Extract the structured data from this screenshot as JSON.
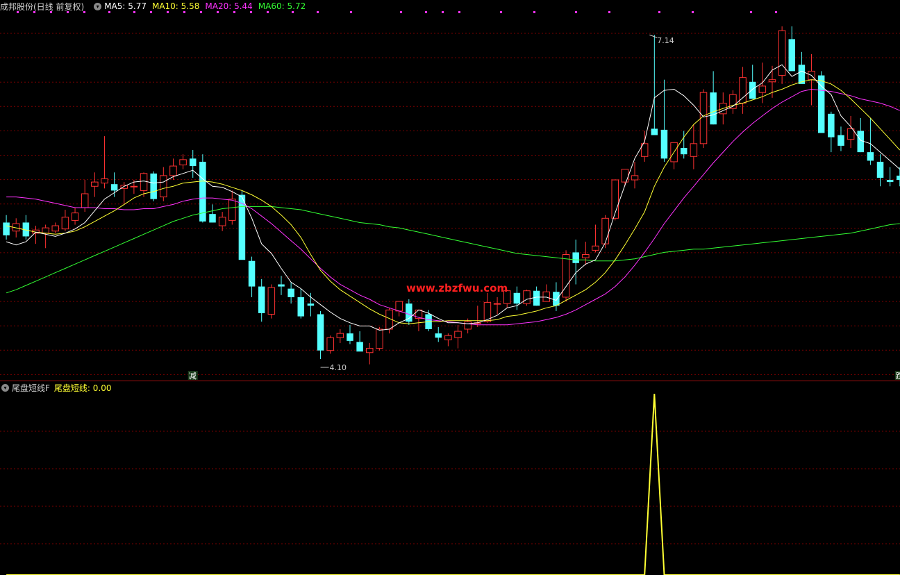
{
  "header": {
    "title": "成邦股份(日线 前复权)",
    "ma5_label": "MA5: 5.77",
    "ma10_label": "MA10: 5.58",
    "ma20_label": "MA20: 5.44",
    "ma60_label": "MA60: 5.72"
  },
  "indicator_header": {
    "name": "尾盘短线F",
    "value_label": "尾盘短线: 0.00"
  },
  "watermark": "www.zbzfwu.com",
  "colors": {
    "up": "#ff3232",
    "down": "#54ffff",
    "ma5": "#ffffff",
    "ma10": "#ffff33",
    "ma20": "#ff33ff",
    "ma60": "#33ff33",
    "grid": "#7a0000",
    "indicator": "#ffff33",
    "watermark": "#ff2020",
    "marker": "#ff33ff"
  },
  "chart_data": [
    {
      "type": "candlestick",
      "series_legend": [
        "MA5",
        "MA10",
        "MA20",
        "MA60"
      ],
      "ylim": [
        3.95,
        7.35
      ],
      "grid": true,
      "annotations": [
        {
          "text": "7.14",
          "kind": "high",
          "index": 66,
          "value": 7.14
        },
        {
          "text": "4.10",
          "kind": "low",
          "index": 32,
          "value": 4.1
        },
        {
          "text": "减",
          "index": 19
        },
        {
          "text": "跌",
          "index": 91
        }
      ],
      "ohlc": [
        [
          5.38,
          5.45,
          5.22,
          5.26
        ],
        [
          5.3,
          5.42,
          5.24,
          5.37
        ],
        [
          5.38,
          5.45,
          5.22,
          5.25
        ],
        [
          5.28,
          5.35,
          5.18,
          5.31
        ],
        [
          5.28,
          5.36,
          5.14,
          5.33
        ],
        [
          5.3,
          5.38,
          5.28,
          5.35
        ],
        [
          5.32,
          5.5,
          5.3,
          5.43
        ],
        [
          5.4,
          5.52,
          5.36,
          5.47
        ],
        [
          5.52,
          5.78,
          5.48,
          5.65
        ],
        [
          5.72,
          5.85,
          5.62,
          5.76
        ],
        [
          5.75,
          6.19,
          5.7,
          5.79
        ],
        [
          5.74,
          5.85,
          5.62,
          5.68
        ],
        [
          5.7,
          5.76,
          5.55,
          5.73
        ],
        [
          5.72,
          5.78,
          5.65,
          5.72
        ],
        [
          5.68,
          5.85,
          5.62,
          5.84
        ],
        [
          5.84,
          5.86,
          5.58,
          5.6
        ],
        [
          5.62,
          5.9,
          5.58,
          5.82
        ],
        [
          5.82,
          5.98,
          5.78,
          5.91
        ],
        [
          5.92,
          6.02,
          5.88,
          5.97
        ],
        [
          5.98,
          6.06,
          5.8,
          5.91
        ],
        [
          5.95,
          6.02,
          5.38,
          5.39
        ],
        [
          5.46,
          5.55,
          5.38,
          5.38
        ],
        [
          5.35,
          5.48,
          5.3,
          5.43
        ],
        [
          5.4,
          5.68,
          5.36,
          5.6
        ],
        [
          5.64,
          5.68,
          5.05,
          5.03
        ],
        [
          5.02,
          5.06,
          4.68,
          4.78
        ],
        [
          4.78,
          4.85,
          4.45,
          4.53
        ],
        [
          4.52,
          4.8,
          4.48,
          4.77
        ],
        [
          4.8,
          4.88,
          4.7,
          4.78
        ],
        [
          4.76,
          4.82,
          4.62,
          4.68
        ],
        [
          4.68,
          4.76,
          4.48,
          4.5
        ],
        [
          4.62,
          4.72,
          4.5,
          4.6
        ],
        [
          4.52,
          4.55,
          4.1,
          4.18
        ],
        [
          4.18,
          4.32,
          4.15,
          4.3
        ],
        [
          4.3,
          4.38,
          4.25,
          4.34
        ],
        [
          4.34,
          4.42,
          4.24,
          4.27
        ],
        [
          4.26,
          4.36,
          4.18,
          4.17
        ],
        [
          4.16,
          4.25,
          4.05,
          4.2
        ],
        [
          4.2,
          4.4,
          4.18,
          4.38
        ],
        [
          4.38,
          4.58,
          4.34,
          4.56
        ],
        [
          4.55,
          4.64,
          4.5,
          4.64
        ],
        [
          4.62,
          4.66,
          4.42,
          4.45
        ],
        [
          4.48,
          4.52,
          4.36,
          4.56
        ],
        [
          4.52,
          4.56,
          4.36,
          4.38
        ],
        [
          4.34,
          4.4,
          4.26,
          4.3
        ],
        [
          4.28,
          4.34,
          4.22,
          4.32
        ],
        [
          4.3,
          4.42,
          4.2,
          4.36
        ],
        [
          4.38,
          4.48,
          4.34,
          4.45
        ],
        [
          4.44,
          4.6,
          4.4,
          4.44
        ],
        [
          4.45,
          4.72,
          4.44,
          4.63
        ],
        [
          4.62,
          4.68,
          4.52,
          4.62
        ],
        [
          4.62,
          4.75,
          4.58,
          4.74
        ],
        [
          4.72,
          4.78,
          4.56,
          4.62
        ],
        [
          4.62,
          4.75,
          4.6,
          4.74
        ],
        [
          4.74,
          4.78,
          4.6,
          4.6
        ],
        [
          4.64,
          4.8,
          4.64,
          4.73
        ],
        [
          4.73,
          4.82,
          4.55,
          4.6
        ],
        [
          4.68,
          5.12,
          4.64,
          5.08
        ],
        [
          5.1,
          5.22,
          4.8,
          5.0
        ],
        [
          5.05,
          5.2,
          4.98,
          5.08
        ],
        [
          5.12,
          5.36,
          5.1,
          5.16
        ],
        [
          5.18,
          5.45,
          5.14,
          5.42
        ],
        [
          5.42,
          5.76,
          5.4,
          5.78
        ],
        [
          5.76,
          5.88,
          5.72,
          5.88
        ],
        [
          5.78,
          5.95,
          5.7,
          5.82
        ],
        [
          6.0,
          6.24,
          5.95,
          6.12
        ],
        [
          6.26,
          7.14,
          6.24,
          6.2
        ],
        [
          6.25,
          6.72,
          5.95,
          5.98
        ],
        [
          5.95,
          6.1,
          5.88,
          6.13
        ],
        [
          6.08,
          6.24,
          5.98,
          6.02
        ],
        [
          6.0,
          6.3,
          5.88,
          6.12
        ],
        [
          6.12,
          6.63,
          6.08,
          6.6
        ],
        [
          6.6,
          6.8,
          6.3,
          6.3
        ],
        [
          6.4,
          6.6,
          6.3,
          6.5
        ],
        [
          6.45,
          6.62,
          6.4,
          6.58
        ],
        [
          6.5,
          6.84,
          6.4,
          6.74
        ],
        [
          6.7,
          6.86,
          6.58,
          6.54
        ],
        [
          6.6,
          6.88,
          6.5,
          6.66
        ],
        [
          6.7,
          6.85,
          6.55,
          6.72
        ],
        [
          6.76,
          7.22,
          6.68,
          7.18
        ],
        [
          7.1,
          7.22,
          6.88,
          6.8
        ],
        [
          6.86,
          6.98,
          6.72,
          6.68
        ],
        [
          6.72,
          6.96,
          6.48,
          6.8
        ],
        [
          6.76,
          6.8,
          6.28,
          6.22
        ],
        [
          6.4,
          6.42,
          6.04,
          6.18
        ],
        [
          6.2,
          6.28,
          6.05,
          6.1
        ],
        [
          6.16,
          6.38,
          6.08,
          6.26
        ],
        [
          6.24,
          6.36,
          6.04,
          6.04
        ],
        [
          6.04,
          6.36,
          5.92,
          5.96
        ],
        [
          5.95,
          6.02,
          5.72,
          5.8
        ],
        [
          5.78,
          5.9,
          5.72,
          5.76
        ],
        [
          5.82,
          5.9,
          5.72,
          5.78
        ]
      ],
      "ma5": [
        5.2,
        5.17,
        5.2,
        5.29,
        5.27,
        5.25,
        5.28,
        5.32,
        5.38,
        5.49,
        5.6,
        5.66,
        5.72,
        5.76,
        5.77,
        5.75,
        5.76,
        5.81,
        5.84,
        5.87,
        5.79,
        5.72,
        5.71,
        5.67,
        5.62,
        5.42,
        5.18,
        5.09,
        4.95,
        4.82,
        4.76,
        4.68,
        4.61,
        4.54,
        4.48,
        4.44,
        4.41,
        4.41,
        4.37,
        4.38,
        4.44,
        4.48,
        4.56,
        4.53,
        4.48,
        4.44,
        4.44,
        4.43,
        4.44,
        4.47,
        4.51,
        4.58,
        4.6,
        4.66,
        4.68,
        4.68,
        4.65,
        4.78,
        4.91,
        4.99,
        5.03,
        5.19,
        5.47,
        5.73,
        5.98,
        6.14,
        6.55,
        6.62,
        6.63,
        6.57,
        6.48,
        6.37,
        6.39,
        6.43,
        6.47,
        6.55,
        6.63,
        6.69,
        6.81,
        6.86,
        6.75,
        6.8,
        6.76,
        6.66,
        6.58,
        6.38,
        6.28,
        6.15,
        6.12,
        6.04,
        5.96,
        5.88
      ],
      "ma10": [
        5.35,
        5.33,
        5.31,
        5.29,
        5.28,
        5.27,
        5.28,
        5.3,
        5.34,
        5.39,
        5.44,
        5.49,
        5.55,
        5.61,
        5.65,
        5.67,
        5.7,
        5.72,
        5.75,
        5.76,
        5.77,
        5.76,
        5.74,
        5.71,
        5.68,
        5.64,
        5.59,
        5.53,
        5.45,
        5.36,
        5.24,
        5.08,
        4.93,
        4.83,
        4.75,
        4.69,
        4.63,
        4.57,
        4.52,
        4.48,
        4.44,
        4.43,
        4.44,
        4.45,
        4.45,
        4.46,
        4.46,
        4.46,
        4.46,
        4.46,
        4.47,
        4.5,
        4.51,
        4.53,
        4.55,
        4.58,
        4.6,
        4.65,
        4.7,
        4.75,
        4.82,
        4.91,
        5.03,
        5.17,
        5.32,
        5.48,
        5.72,
        5.9,
        6.04,
        6.18,
        6.3,
        6.38,
        6.42,
        6.45,
        6.48,
        6.5,
        6.53,
        6.56,
        6.6,
        6.63,
        6.67,
        6.7,
        6.72,
        6.71,
        6.68,
        6.62,
        6.54,
        6.45,
        6.36,
        6.26,
        6.16,
        6.06
      ],
      "ma20": [
        5.62,
        5.62,
        5.61,
        5.6,
        5.58,
        5.56,
        5.54,
        5.52,
        5.52,
        5.52,
        5.51,
        5.51,
        5.5,
        5.5,
        5.51,
        5.51,
        5.53,
        5.55,
        5.58,
        5.6,
        5.61,
        5.61,
        5.6,
        5.59,
        5.56,
        5.51,
        5.44,
        5.37,
        5.29,
        5.21,
        5.13,
        5.04,
        4.95,
        4.87,
        4.8,
        4.75,
        4.7,
        4.66,
        4.61,
        4.58,
        4.55,
        4.52,
        4.49,
        4.47,
        4.46,
        4.45,
        4.44,
        4.43,
        4.42,
        4.42,
        4.42,
        4.42,
        4.43,
        4.44,
        4.45,
        4.47,
        4.49,
        4.52,
        4.56,
        4.61,
        4.66,
        4.71,
        4.78,
        4.87,
        4.98,
        5.1,
        5.23,
        5.37,
        5.49,
        5.61,
        5.72,
        5.83,
        5.94,
        6.04,
        6.14,
        6.23,
        6.31,
        6.38,
        6.45,
        6.51,
        6.56,
        6.61,
        6.63,
        6.62,
        6.61,
        6.59,
        6.57,
        6.54,
        6.52,
        6.5,
        6.47,
        6.43
      ],
      "ma60": [
        4.72,
        4.75,
        4.79,
        4.83,
        4.87,
        4.91,
        4.95,
        4.99,
        5.03,
        5.07,
        5.11,
        5.15,
        5.19,
        5.23,
        5.27,
        5.31,
        5.35,
        5.39,
        5.42,
        5.45,
        5.47,
        5.49,
        5.51,
        5.52,
        5.53,
        5.53,
        5.53,
        5.53,
        5.52,
        5.51,
        5.5,
        5.48,
        5.46,
        5.44,
        5.42,
        5.4,
        5.38,
        5.37,
        5.36,
        5.34,
        5.33,
        5.31,
        5.29,
        5.27,
        5.25,
        5.23,
        5.21,
        5.19,
        5.17,
        5.15,
        5.13,
        5.11,
        5.09,
        5.08,
        5.07,
        5.06,
        5.05,
        5.04,
        5.03,
        5.03,
        5.02,
        5.02,
        5.02,
        5.03,
        5.04,
        5.06,
        5.08,
        5.1,
        5.11,
        5.12,
        5.13,
        5.13,
        5.14,
        5.15,
        5.16,
        5.17,
        5.18,
        5.19,
        5.2,
        5.21,
        5.22,
        5.23,
        5.24,
        5.25,
        5.26,
        5.27,
        5.28,
        5.3,
        5.32,
        5.34,
        5.36,
        5.37
      ]
    },
    {
      "type": "line",
      "series_legend": [
        "尾盘短线"
      ],
      "ylim": [
        0,
        1.0
      ],
      "grid": true,
      "x": [
        0,
        1,
        2,
        3,
        4,
        5,
        6,
        7,
        8,
        9,
        10,
        11,
        12,
        13,
        14,
        15,
        16,
        17,
        18,
        19,
        20,
        21,
        22,
        23,
        24,
        25,
        26,
        27,
        28,
        29,
        30,
        31,
        32,
        33,
        34,
        35,
        36,
        37,
        38,
        39,
        40,
        41,
        42,
        43,
        44,
        45,
        46,
        47,
        48,
        49,
        50,
        51,
        52,
        53,
        54,
        55,
        56,
        57,
        58,
        59,
        60,
        61,
        62,
        63,
        64,
        65,
        66,
        67,
        68,
        69,
        70,
        71,
        72,
        73,
        74,
        75,
        76,
        77,
        78,
        79,
        80,
        81,
        82,
        83,
        84,
        85,
        86,
        87,
        88,
        89,
        90,
        91
      ],
      "values": [
        0,
        0,
        0,
        0,
        0,
        0,
        0,
        0,
        0,
        0,
        0,
        0,
        0,
        0,
        0,
        0,
        0,
        0,
        0,
        0,
        0,
        0,
        0,
        0,
        0,
        0,
        0,
        0,
        0,
        0,
        0,
        0,
        0,
        0,
        0,
        0,
        0,
        0,
        0,
        0,
        0,
        0,
        0,
        0,
        0,
        0,
        0,
        0,
        0,
        0,
        0,
        0,
        0,
        0,
        0,
        0,
        0,
        0,
        0,
        0,
        0,
        0,
        0,
        0,
        0,
        0,
        1,
        0,
        0,
        0,
        0,
        0,
        0,
        0,
        0,
        0,
        0,
        0,
        0,
        0,
        0,
        0,
        0,
        0,
        0,
        0,
        0,
        0,
        0,
        0,
        0,
        0
      ]
    }
  ]
}
